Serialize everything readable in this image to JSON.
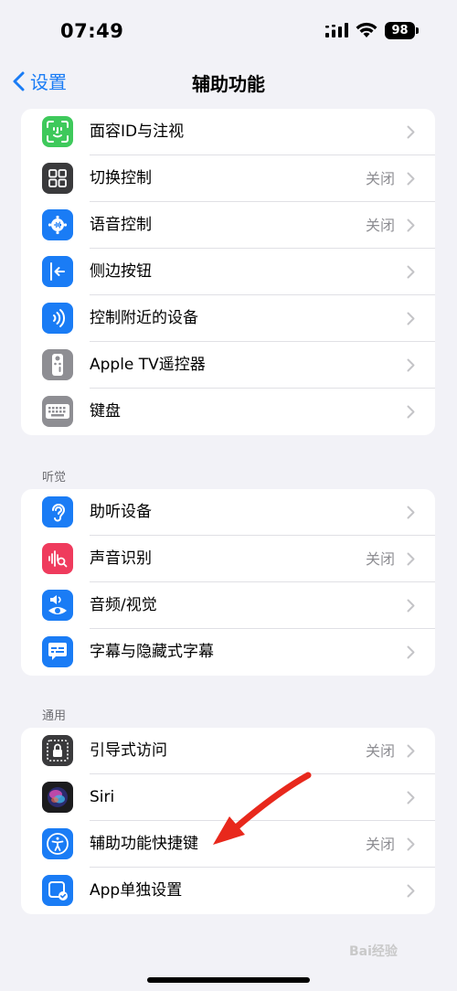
{
  "status": {
    "time": "07:49",
    "battery": "98"
  },
  "nav": {
    "back_label": "设置",
    "title": "辅助功能"
  },
  "group1": [
    {
      "label": "面容ID与注视",
      "value": "",
      "icon": "face-id-icon"
    },
    {
      "label": "切换控制",
      "value": "关闭",
      "icon": "switch-control-icon"
    },
    {
      "label": "语音控制",
      "value": "关闭",
      "icon": "voice-control-icon"
    },
    {
      "label": "侧边按钮",
      "value": "",
      "icon": "side-button-icon"
    },
    {
      "label": "控制附近的设备",
      "value": "",
      "icon": "nearby-devices-icon"
    },
    {
      "label": "Apple TV遥控器",
      "value": "",
      "icon": "apple-tv-remote-icon"
    },
    {
      "label": "键盘",
      "value": "",
      "icon": "keyboard-icon"
    }
  ],
  "hearing_header": "听觉",
  "group2": [
    {
      "label": "助听设备",
      "value": "",
      "icon": "hearing-devices-icon"
    },
    {
      "label": "声音识别",
      "value": "关闭",
      "icon": "sound-recognition-icon"
    },
    {
      "label": "音频/视觉",
      "value": "",
      "icon": "audio-visual-icon"
    },
    {
      "label": "字幕与隐藏式字幕",
      "value": "",
      "icon": "subtitles-icon"
    }
  ],
  "general_header": "通用",
  "group3": [
    {
      "label": "引导式访问",
      "value": "关闭",
      "icon": "guided-access-icon"
    },
    {
      "label": "Siri",
      "value": "",
      "icon": "siri-icon"
    },
    {
      "label": "辅助功能快捷键",
      "value": "关闭",
      "icon": "accessibility-shortcut-icon"
    },
    {
      "label": "App单独设置",
      "value": "",
      "icon": "per-app-settings-icon"
    }
  ],
  "watermark": "Bai经验",
  "colors": {
    "accent": "#1a7cf5",
    "annotation_arrow": "#e8281c"
  }
}
